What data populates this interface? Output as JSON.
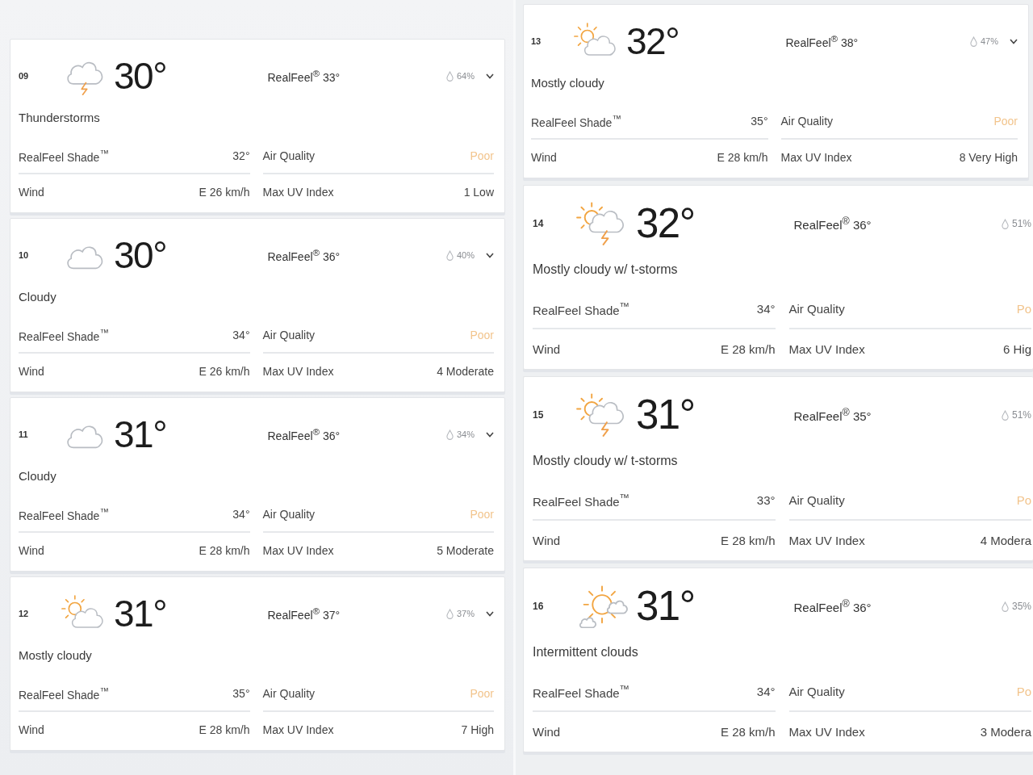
{
  "panels": [
    {
      "hours": [
        {
          "time": "09",
          "kind": "storm",
          "temperature": "30°",
          "realfeel": "RealFeel$^{®}$ 33°",
          "precipitation": "64%",
          "toggle": true,
          "condition": "Thunderstorms",
          "details": [
            {
              "kind": "plain",
              "label": "RealFeel Shade$^{™}$",
              "value": "32°"
            },
            {
              "kind": "rating",
              "label": "Air Quality",
              "value": "Poor"
            },
            {
              "kind": "plain",
              "label": "Wind",
              "value": "E 26 km/h"
            },
            {
              "kind": "plain",
              "label": "Max UV Index",
              "value": "1 Low"
            }
          ]
        },
        {
          "time": "10",
          "kind": "cloud",
          "temperature": "30°",
          "realfeel": "RealFeel$^{®}$ 36°",
          "precipitation": "40%",
          "toggle": true,
          "condition": "Cloudy",
          "details": [
            {
              "kind": "plain",
              "label": "RealFeel Shade$^{™}$",
              "value": "34°"
            },
            {
              "kind": "rating",
              "label": "Air Quality",
              "value": "Poor"
            },
            {
              "kind": "plain",
              "label": "Wind",
              "value": "E 26 km/h"
            },
            {
              "kind": "plain",
              "label": "Max UV Index",
              "value": "4 Moderate"
            }
          ]
        },
        {
          "time": "11",
          "kind": "cloud",
          "temperature": "31°",
          "realfeel": "RealFeel$^{®}$ 36°",
          "precipitation": "34%",
          "toggle": true,
          "condition": "Cloudy",
          "details": [
            {
              "kind": "plain",
              "label": "RealFeel Shade$^{™}$",
              "value": "34°"
            },
            {
              "kind": "rating",
              "label": "Air Quality",
              "value": "Poor"
            },
            {
              "kind": "plain",
              "label": "Wind",
              "value": "E 28 km/h"
            },
            {
              "kind": "plain",
              "label": "Max UV Index",
              "value": "5 Moderate"
            }
          ]
        },
        {
          "time": "12",
          "kind": "suncloud",
          "temperature": "31°",
          "realfeel": "RealFeel$^{®}$ 37°",
          "precipitation": "37%",
          "toggle": true,
          "condition": "Mostly cloudy",
          "details": [
            {
              "kind": "plain",
              "label": "RealFeel Shade$^{™}$",
              "value": "35°"
            },
            {
              "kind": "rating",
              "label": "Air Quality",
              "value": "Poor"
            },
            {
              "kind": "plain",
              "label": "Wind",
              "value": "E 28 km/h"
            },
            {
              "kind": "plain",
              "label": "Max UV Index",
              "value": "7 High"
            }
          ]
        }
      ]
    },
    {
      "hours": [
        {
          "time": "13",
          "kind": "suncloud",
          "temperature": "32°",
          "realfeel": "RealFeel$^{®}$ 38°",
          "precipitation": "47%",
          "toggle": true,
          "condition": "Mostly cloudy",
          "details": [
            {
              "kind": "plain",
              "label": "RealFeel Shade$^{™}$",
              "value": "35°"
            },
            {
              "kind": "rating",
              "label": "Air Quality",
              "value": "Poor"
            },
            {
              "kind": "plain",
              "label": "Wind",
              "value": "E 28 km/h"
            },
            {
              "kind": "plain",
              "label": "Max UV Index",
              "value": "8 Very High"
            }
          ]
        },
        {
          "time": "14",
          "kind": "sunstorm",
          "temperature": "32°",
          "realfeel": "RealFeel$^{®}$ 36°",
          "precipitation": "51%",
          "toggle": false,
          "condition": "Mostly cloudy w/ t-storms",
          "details": [
            {
              "kind": "plain",
              "label": "RealFeel Shade$^{™}$",
              "value": "34°"
            },
            {
              "kind": "rating",
              "label": "Air Quality",
              "value": "Po"
            },
            {
              "kind": "plain",
              "label": "Wind",
              "value": "E 28 km/h"
            },
            {
              "kind": "plain",
              "label": "Max UV Index",
              "value": "6 Hig"
            }
          ]
        },
        {
          "time": "15",
          "kind": "sunstorm",
          "temperature": "31°",
          "realfeel": "RealFeel$^{®}$ 35°",
          "precipitation": "51%",
          "toggle": false,
          "condition": "Mostly cloudy w/ t-storms",
          "details": [
            {
              "kind": "plain",
              "label": "RealFeel Shade$^{™}$",
              "value": "33°"
            },
            {
              "kind": "rating",
              "label": "Air Quality",
              "value": "Po"
            },
            {
              "kind": "plain",
              "label": "Wind",
              "value": "E 28 km/h"
            },
            {
              "kind": "plain",
              "label": "Max UV Index",
              "value": "4 Modera"
            }
          ]
        },
        {
          "time": "16",
          "kind": "intermittent",
          "temperature": "31°",
          "realfeel": "RealFeel$^{®}$ 36°",
          "precipitation": "35%",
          "toggle": false,
          "condition": "Intermittent clouds",
          "details": [
            {
              "kind": "plain",
              "label": "RealFeel Shade$^{™}$",
              "value": "34°"
            },
            {
              "kind": "rating",
              "label": "Air Quality",
              "value": "Po"
            },
            {
              "kind": "plain",
              "label": "Wind",
              "value": "E 28 km/h"
            },
            {
              "kind": "plain",
              "label": "Max UV Index",
              "value": "3 Modera"
            }
          ]
        }
      ]
    }
  ]
}
